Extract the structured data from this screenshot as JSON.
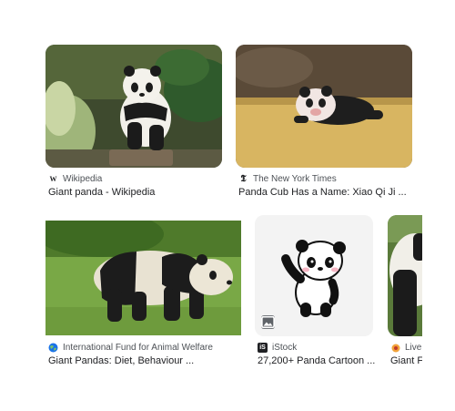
{
  "results": [
    {
      "source": "Wikipedia",
      "source_icon": "wikipedia-w-icon",
      "favicon_text": "W",
      "title": "Giant panda - Wikipedia"
    },
    {
      "source": "The New York Times",
      "source_icon": "nyt-logo-icon",
      "favicon_text": "𝕿",
      "title": "Panda Cub Has a Name: Xiao Qi Ji ..."
    },
    {
      "source": "International Fund for Animal Welfare",
      "source_icon": "globe-icon",
      "title": "Giant Pandas: Diet, Behaviour ..."
    },
    {
      "source": "iStock",
      "source_icon": "istock-logo-icon",
      "favicon_text": "iS",
      "title": "27,200+ Panda Cartoon ..."
    },
    {
      "source": "Live S",
      "source_icon": "live-science-icon",
      "title": "Giant F"
    }
  ],
  "colors": {
    "text_primary": "#202124",
    "text_secondary": "#4d5156",
    "badge": "#5f6368"
  }
}
